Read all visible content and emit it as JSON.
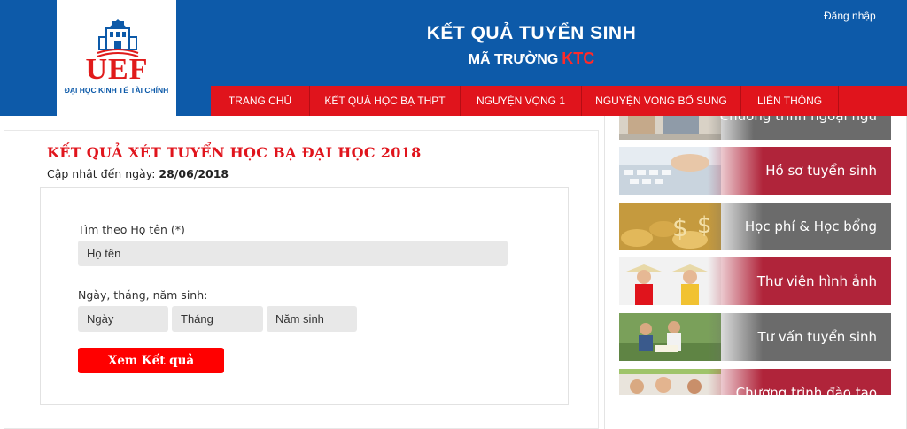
{
  "header": {
    "logo_text": "UEF",
    "logo_subtitle": "ĐẠI HỌC KINH TẾ TÀI CHÍNH",
    "title": "KẾT QUẢ TUYỂN SINH",
    "subtitle_prefix": "MÃ TRƯỜNG",
    "school_code": "KTC",
    "login_label": "Đăng nhập"
  },
  "nav": {
    "items": [
      {
        "label": "TRANG CHỦ"
      },
      {
        "label": "KẾT QUẢ HỌC BẠ THPT"
      },
      {
        "label": "NGUYỆN VỌNG 1"
      },
      {
        "label": "NGUYỆN VỌNG BỔ SUNG"
      },
      {
        "label": "LIÊN THÔNG"
      }
    ]
  },
  "main": {
    "page_title": "KẾT QUẢ XÉT TUYỂN HỌC BẠ ĐẠI HỌC 2018",
    "updated_label": "Cập nhật đến ngày:",
    "updated_date": "28/06/2018",
    "form": {
      "name_label": "Tìm theo Họ tên (*)",
      "name_placeholder": "Họ tên",
      "dob_label": "Ngày, tháng, năm sinh:",
      "day_placeholder": "Ngày",
      "month_placeholder": "Tháng",
      "year_placeholder": "Năm sinh",
      "submit_label": "Xem Kết quả"
    }
  },
  "sidebar": {
    "banners": [
      {
        "label": "Chương trình ngoại ngữ"
      },
      {
        "label": "Hồ sơ tuyển sinh"
      },
      {
        "label": "Học phí & Học bổng"
      },
      {
        "label": "Thư viện hình ảnh"
      },
      {
        "label": "Tư vấn tuyển sinh"
      },
      {
        "label": "Chương trình đào tạo"
      }
    ]
  },
  "colors": {
    "header_blue": "#0d5aa9",
    "nav_red": "#e0141c",
    "title_red": "#e0141c",
    "button_red": "#ff0000",
    "banner_crimson": "#b0243a",
    "banner_gray": "#6b6b6b"
  }
}
